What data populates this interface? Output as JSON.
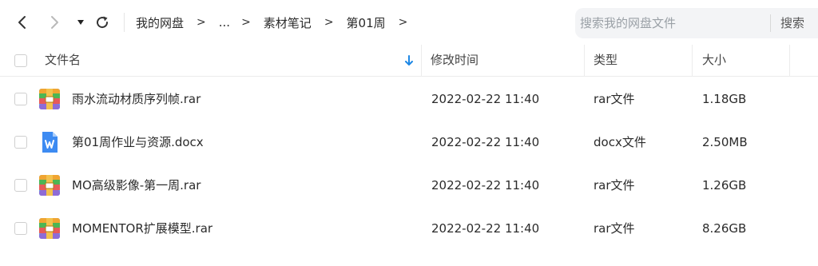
{
  "nav": {
    "back_icon": "chevron-left-icon",
    "forward_icon": "chevron-right-icon",
    "history_icon": "caret-down-icon",
    "refresh_icon": "refresh-icon"
  },
  "breadcrumb": {
    "items": [
      "我的网盘",
      "...",
      "素材笔记",
      "第01周"
    ],
    "separator": ">"
  },
  "search": {
    "placeholder": "搜索我的网盘文件",
    "value": "",
    "button_label": "搜索"
  },
  "table": {
    "columns": {
      "name": "文件名",
      "modified": "修改时间",
      "type": "类型",
      "size": "大小"
    },
    "sort_icon": "sort-down-arrow-icon",
    "accent_color": "#1e88e5",
    "rows": [
      {
        "name": "雨水流动材质序列帧.rar",
        "modified": "2022-02-22 11:40",
        "type": "rar文件",
        "size": "1.18GB",
        "icon": "rar-archive-icon"
      },
      {
        "name": "第01周作业与资源.docx",
        "modified": "2022-02-22 11:40",
        "type": "docx文件",
        "size": "2.50MB",
        "icon": "word-document-icon"
      },
      {
        "name": "MO高级影像-第一周.rar",
        "modified": "2022-02-22 11:40",
        "type": "rar文件",
        "size": "1.26GB",
        "icon": "rar-archive-icon"
      },
      {
        "name": "MOMENTOR扩展模型.rar",
        "modified": "2022-02-22 11:40",
        "type": "rar文件",
        "size": "8.26GB",
        "icon": "rar-archive-icon"
      }
    ]
  }
}
